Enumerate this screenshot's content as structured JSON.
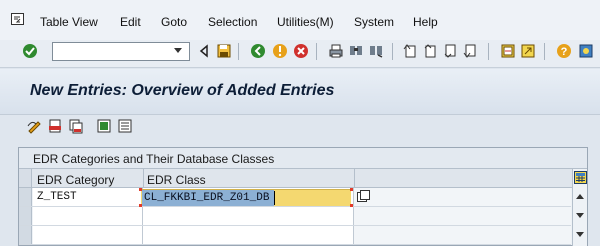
{
  "menu": {
    "items": [
      "Table View",
      "Edit",
      "Goto",
      "Selection",
      "Utilities(M)",
      "System",
      "Help"
    ]
  },
  "toolbar": {
    "command_field": {
      "value": "",
      "placeholder": ""
    },
    "icons": [
      "enter-checkmark-icon",
      "back-icon",
      "save-icon",
      "exit-icon",
      "cancel-icon",
      "print-icon",
      "find-icon",
      "find-next-icon",
      "first-page-icon",
      "previous-page-icon",
      "next-page-icon",
      "last-page-icon",
      "create-session-icon",
      "shortcut-icon",
      "help-icon",
      "customize-layout-icon"
    ]
  },
  "title": "New Entries: Overview of Added Entries",
  "app_toolbar": {
    "icons": [
      "change-display-icon",
      "delete-icon",
      "copy-as-icon",
      "select-all-icon",
      "deselect-all-icon"
    ]
  },
  "table": {
    "caption": "EDR Categories and Their Database Classes",
    "columns": [
      "EDR Category",
      "EDR Class"
    ],
    "rows": [
      {
        "category": "Z_TEST",
        "class": "CL_FKKBI_EDR_Z01_DB"
      },
      {
        "category": "",
        "class": ""
      },
      {
        "category": "",
        "class": ""
      }
    ]
  },
  "colors": {
    "title_text": "#0d1e37",
    "input_highlight": "#f4d870",
    "selection": "#8cb0d4"
  }
}
